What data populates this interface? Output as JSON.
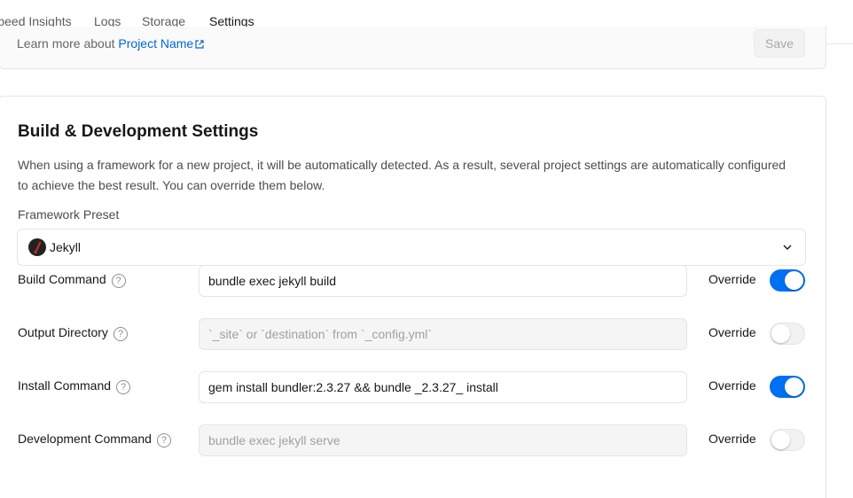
{
  "tabs": [
    {
      "label": "Speed Insights"
    },
    {
      "label": "Logs"
    },
    {
      "label": "Storage"
    },
    {
      "label": "Settings",
      "active": true
    }
  ],
  "prev_card": {
    "learn_text": "Learn more about ",
    "link_text": "Project Name",
    "save_label": "Save"
  },
  "build": {
    "title": "Build & Development Settings",
    "description": "When using a framework for a new project, it will be automatically detected. As a result, several project settings are automatically configured to achieve the best result. You can override them below.",
    "preset_label": "Framework Preset",
    "preset_value": "Jekyll",
    "override_label": "Override",
    "help_glyph": "?",
    "rows": [
      {
        "label": "Build Command",
        "value": "bundle exec jekyll build",
        "placeholder": "",
        "override": true
      },
      {
        "label": "Output Directory",
        "value": "",
        "placeholder": "`_site` or `destination` from `_config.yml`",
        "override": false
      },
      {
        "label": "Install Command",
        "value": "gem install bundler:2.3.27 && bundle _2.3.27_ install",
        "placeholder": "",
        "override": true
      },
      {
        "label": "Development Command",
        "value": "",
        "placeholder": "bundle exec jekyll serve",
        "override": false
      }
    ]
  },
  "colors": {
    "accent": "#0070f3",
    "link": "#0068d6",
    "border": "#e5e5e5"
  }
}
